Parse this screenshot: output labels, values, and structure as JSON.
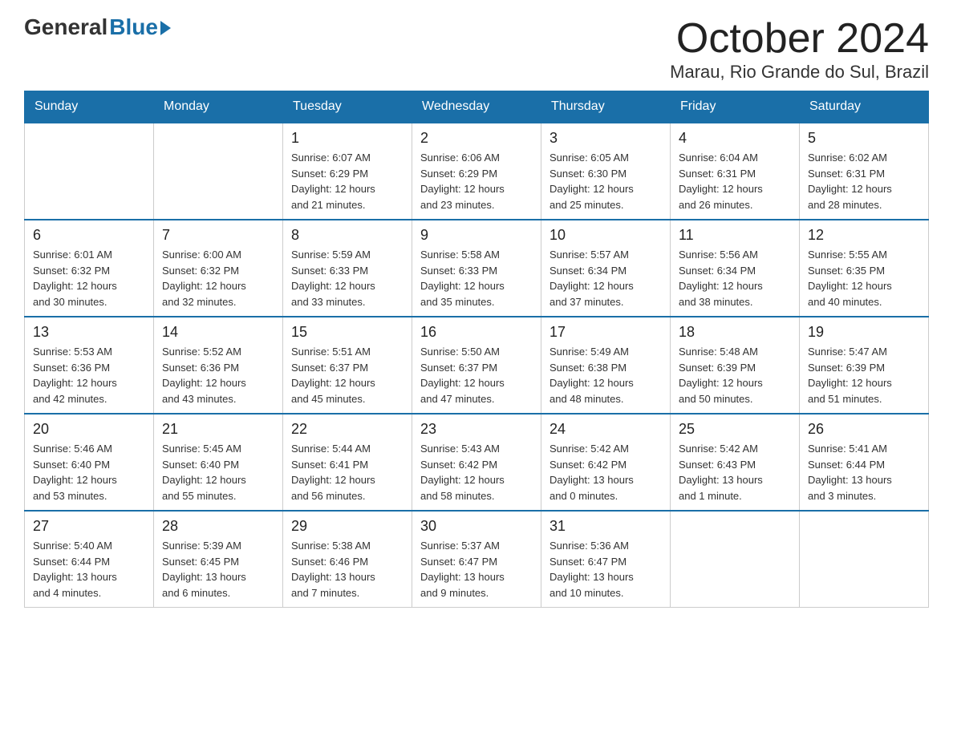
{
  "header": {
    "logo_general": "General",
    "logo_blue": "Blue",
    "month_title": "October 2024",
    "location": "Marau, Rio Grande do Sul, Brazil"
  },
  "weekdays": [
    "Sunday",
    "Monday",
    "Tuesday",
    "Wednesday",
    "Thursday",
    "Friday",
    "Saturday"
  ],
  "weeks": [
    [
      {
        "day": "",
        "info": ""
      },
      {
        "day": "",
        "info": ""
      },
      {
        "day": "1",
        "info": "Sunrise: 6:07 AM\nSunset: 6:29 PM\nDaylight: 12 hours\nand 21 minutes."
      },
      {
        "day": "2",
        "info": "Sunrise: 6:06 AM\nSunset: 6:29 PM\nDaylight: 12 hours\nand 23 minutes."
      },
      {
        "day": "3",
        "info": "Sunrise: 6:05 AM\nSunset: 6:30 PM\nDaylight: 12 hours\nand 25 minutes."
      },
      {
        "day": "4",
        "info": "Sunrise: 6:04 AM\nSunset: 6:31 PM\nDaylight: 12 hours\nand 26 minutes."
      },
      {
        "day": "5",
        "info": "Sunrise: 6:02 AM\nSunset: 6:31 PM\nDaylight: 12 hours\nand 28 minutes."
      }
    ],
    [
      {
        "day": "6",
        "info": "Sunrise: 6:01 AM\nSunset: 6:32 PM\nDaylight: 12 hours\nand 30 minutes."
      },
      {
        "day": "7",
        "info": "Sunrise: 6:00 AM\nSunset: 6:32 PM\nDaylight: 12 hours\nand 32 minutes."
      },
      {
        "day": "8",
        "info": "Sunrise: 5:59 AM\nSunset: 6:33 PM\nDaylight: 12 hours\nand 33 minutes."
      },
      {
        "day": "9",
        "info": "Sunrise: 5:58 AM\nSunset: 6:33 PM\nDaylight: 12 hours\nand 35 minutes."
      },
      {
        "day": "10",
        "info": "Sunrise: 5:57 AM\nSunset: 6:34 PM\nDaylight: 12 hours\nand 37 minutes."
      },
      {
        "day": "11",
        "info": "Sunrise: 5:56 AM\nSunset: 6:34 PM\nDaylight: 12 hours\nand 38 minutes."
      },
      {
        "day": "12",
        "info": "Sunrise: 5:55 AM\nSunset: 6:35 PM\nDaylight: 12 hours\nand 40 minutes."
      }
    ],
    [
      {
        "day": "13",
        "info": "Sunrise: 5:53 AM\nSunset: 6:36 PM\nDaylight: 12 hours\nand 42 minutes."
      },
      {
        "day": "14",
        "info": "Sunrise: 5:52 AM\nSunset: 6:36 PM\nDaylight: 12 hours\nand 43 minutes."
      },
      {
        "day": "15",
        "info": "Sunrise: 5:51 AM\nSunset: 6:37 PM\nDaylight: 12 hours\nand 45 minutes."
      },
      {
        "day": "16",
        "info": "Sunrise: 5:50 AM\nSunset: 6:37 PM\nDaylight: 12 hours\nand 47 minutes."
      },
      {
        "day": "17",
        "info": "Sunrise: 5:49 AM\nSunset: 6:38 PM\nDaylight: 12 hours\nand 48 minutes."
      },
      {
        "day": "18",
        "info": "Sunrise: 5:48 AM\nSunset: 6:39 PM\nDaylight: 12 hours\nand 50 minutes."
      },
      {
        "day": "19",
        "info": "Sunrise: 5:47 AM\nSunset: 6:39 PM\nDaylight: 12 hours\nand 51 minutes."
      }
    ],
    [
      {
        "day": "20",
        "info": "Sunrise: 5:46 AM\nSunset: 6:40 PM\nDaylight: 12 hours\nand 53 minutes."
      },
      {
        "day": "21",
        "info": "Sunrise: 5:45 AM\nSunset: 6:40 PM\nDaylight: 12 hours\nand 55 minutes."
      },
      {
        "day": "22",
        "info": "Sunrise: 5:44 AM\nSunset: 6:41 PM\nDaylight: 12 hours\nand 56 minutes."
      },
      {
        "day": "23",
        "info": "Sunrise: 5:43 AM\nSunset: 6:42 PM\nDaylight: 12 hours\nand 58 minutes."
      },
      {
        "day": "24",
        "info": "Sunrise: 5:42 AM\nSunset: 6:42 PM\nDaylight: 13 hours\nand 0 minutes."
      },
      {
        "day": "25",
        "info": "Sunrise: 5:42 AM\nSunset: 6:43 PM\nDaylight: 13 hours\nand 1 minute."
      },
      {
        "day": "26",
        "info": "Sunrise: 5:41 AM\nSunset: 6:44 PM\nDaylight: 13 hours\nand 3 minutes."
      }
    ],
    [
      {
        "day": "27",
        "info": "Sunrise: 5:40 AM\nSunset: 6:44 PM\nDaylight: 13 hours\nand 4 minutes."
      },
      {
        "day": "28",
        "info": "Sunrise: 5:39 AM\nSunset: 6:45 PM\nDaylight: 13 hours\nand 6 minutes."
      },
      {
        "day": "29",
        "info": "Sunrise: 5:38 AM\nSunset: 6:46 PM\nDaylight: 13 hours\nand 7 minutes."
      },
      {
        "day": "30",
        "info": "Sunrise: 5:37 AM\nSunset: 6:47 PM\nDaylight: 13 hours\nand 9 minutes."
      },
      {
        "day": "31",
        "info": "Sunrise: 5:36 AM\nSunset: 6:47 PM\nDaylight: 13 hours\nand 10 minutes."
      },
      {
        "day": "",
        "info": ""
      },
      {
        "day": "",
        "info": ""
      }
    ]
  ]
}
